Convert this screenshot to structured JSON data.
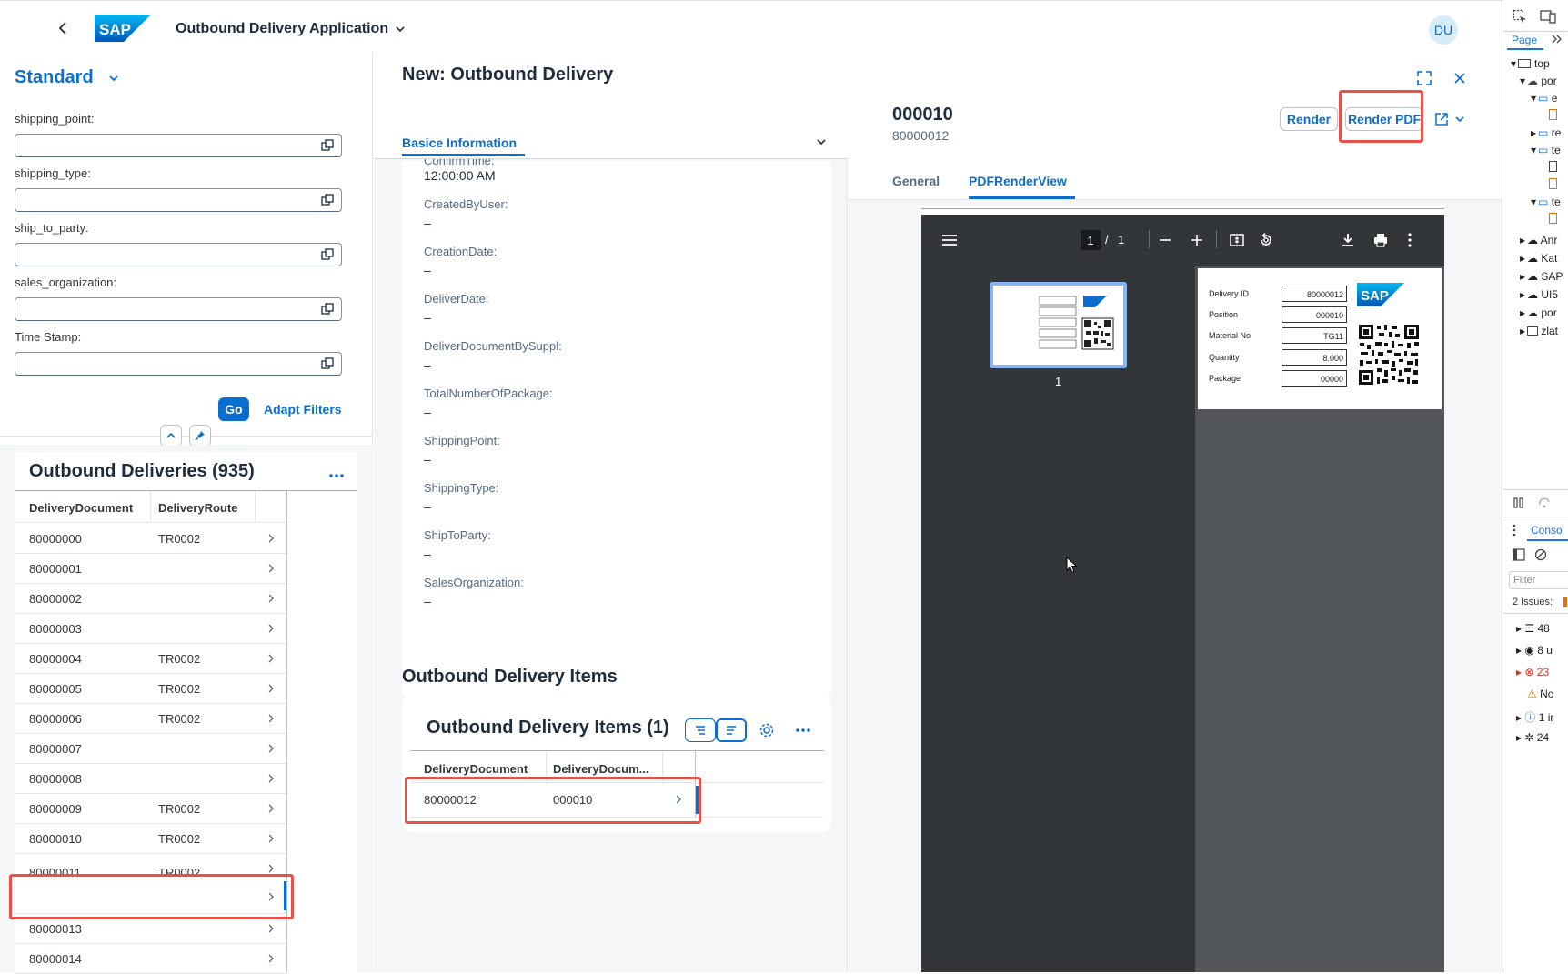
{
  "shell": {
    "app_title": "Outbound Delivery Application",
    "avatar": "DU",
    "logo_text": "SAP"
  },
  "filter_bar": {
    "variant": "Standard",
    "fields": [
      {
        "label": "shipping_point:",
        "value": ""
      },
      {
        "label": "shipping_type:",
        "value": ""
      },
      {
        "label": "ship_to_party:",
        "value": ""
      },
      {
        "label": "sales_organization:",
        "value": ""
      },
      {
        "label": "Time Stamp:",
        "value": ""
      }
    ],
    "go_label": "Go",
    "adapt_label": "Adapt Filters"
  },
  "list": {
    "title": "Outbound Deliveries (935)",
    "columns": [
      "DeliveryDocument",
      "DeliveryRoute"
    ],
    "rows": [
      {
        "doc": "80000000",
        "route": "TR0002"
      },
      {
        "doc": "80000001",
        "route": ""
      },
      {
        "doc": "80000002",
        "route": ""
      },
      {
        "doc": "80000003",
        "route": ""
      },
      {
        "doc": "80000004",
        "route": "TR0002"
      },
      {
        "doc": "80000005",
        "route": "TR0002"
      },
      {
        "doc": "80000006",
        "route": "TR0002"
      },
      {
        "doc": "80000007",
        "route": ""
      },
      {
        "doc": "80000008",
        "route": ""
      },
      {
        "doc": "80000009",
        "route": "TR0002"
      },
      {
        "doc": "80000010",
        "route": "TR0002"
      },
      {
        "doc": "80000011",
        "route": "TR0002"
      },
      {
        "doc": "",
        "route": ""
      },
      {
        "doc": "80000013",
        "route": ""
      },
      {
        "doc": "80000014",
        "route": ""
      }
    ]
  },
  "detail": {
    "title": "New: Outbound Delivery",
    "tab": "Basice Information",
    "partial_label": "ConfirmTime:",
    "partial_value": "12:00:00 AM",
    "fields": [
      {
        "label": "CreatedByUser:",
        "value": "–"
      },
      {
        "label": "CreationDate:",
        "value": "–"
      },
      {
        "label": "DeliverDate:",
        "value": "–"
      },
      {
        "label": "DeliverDocumentBySuppl:",
        "value": "–"
      },
      {
        "label": "TotalNumberOfPackage:",
        "value": "–"
      },
      {
        "label": "ShippingPoint:",
        "value": "–"
      },
      {
        "label": "ShippingType:",
        "value": "–"
      },
      {
        "label": "ShipToParty:",
        "value": "–"
      },
      {
        "label": "SalesOrganization:",
        "value": "–"
      }
    ],
    "section_title": "Outbound Delivery Items",
    "items_title": "Outbound Delivery Items (1)",
    "items_columns": [
      "DeliveryDocument",
      "DeliveryDocum..."
    ],
    "items_rows": [
      {
        "doc": "80000012",
        "item": "000010"
      }
    ]
  },
  "object": {
    "title": "000010",
    "subtitle": "80000012",
    "render_label": "Render",
    "render_pdf_label": "Render PDF",
    "tabs": [
      "General",
      "PDFRenderView"
    ],
    "pdf": {
      "page_current": "1",
      "page_sep": "/",
      "page_total": "1",
      "thumb_label": "1",
      "form": [
        {
          "label": "Delivery ID",
          "value": "80000012"
        },
        {
          "label": "Position",
          "value": "000010"
        },
        {
          "label": "Material No",
          "value": "TG11"
        },
        {
          "label": "Quantity",
          "value": "8.000"
        },
        {
          "label": "Package",
          "value": "00000"
        }
      ]
    }
  },
  "devtools": {
    "tab_page": "Page",
    "tree": [
      "top",
      "por",
      "e",
      "",
      "re",
      "te",
      "",
      "",
      "te",
      "",
      "Anr",
      "Kat",
      "SAP",
      "UI5",
      "por",
      "zlat"
    ],
    "console_tab": "Conso",
    "filter_placeholder": "Filter",
    "issues": "2 Issues:",
    "messages": [
      "48",
      "8 u",
      "23",
      "No",
      "1 ir",
      "24"
    ]
  },
  "colors": {
    "accent": "#0a6ed1",
    "highlight": "#e8514a",
    "pdf_dark": "#323639"
  }
}
